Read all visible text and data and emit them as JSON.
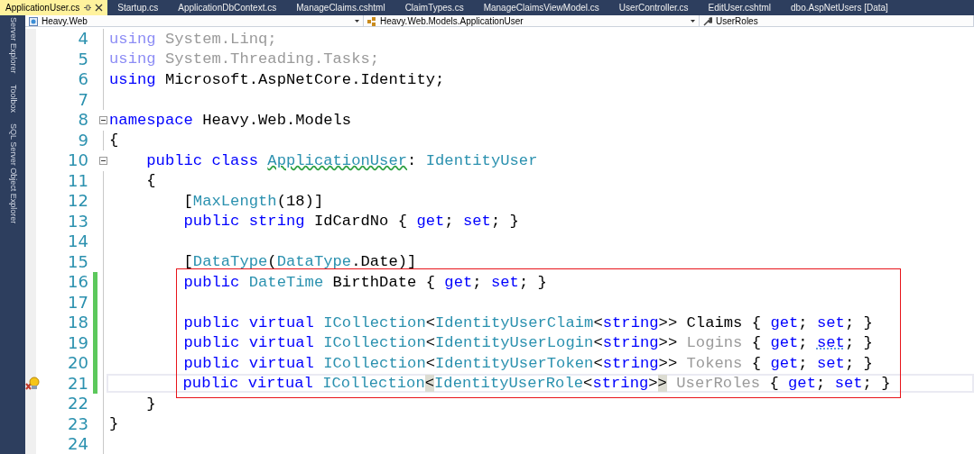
{
  "tabs": [
    {
      "label": "ApplicationUser.cs",
      "selected": true
    },
    {
      "label": "Startup.cs",
      "selected": false
    },
    {
      "label": "ApplicationDbContext.cs",
      "selected": false
    },
    {
      "label": "ManageClaims.cshtml",
      "selected": false
    },
    {
      "label": "ClaimTypes.cs",
      "selected": false
    },
    {
      "label": "ManageClaimsViewModel.cs",
      "selected": false
    },
    {
      "label": "UserController.cs",
      "selected": false
    },
    {
      "label": "EditUser.cshtml",
      "selected": false
    },
    {
      "label": "dbo.AspNetUsers [Data]",
      "selected": false
    }
  ],
  "side_panels": [
    "Server Explorer",
    "Toolbox",
    "SQL Server Object Explorer"
  ],
  "navigation": {
    "project": "Heavy.Web",
    "class": "Heavy.Web.Models.ApplicationUser",
    "member": "UserRoles"
  },
  "lines": [
    {
      "number": "4",
      "changed": false,
      "foldable": false,
      "current": false,
      "lightbulb": false,
      "tokens": [
        {
          "text": "using",
          "kind": "faded-keyword"
        },
        {
          "text": " System.Linq;",
          "kind": "faded"
        }
      ]
    },
    {
      "number": "5",
      "changed": false,
      "foldable": false,
      "current": false,
      "lightbulb": false,
      "tokens": [
        {
          "text": "using",
          "kind": "faded-keyword"
        },
        {
          "text": " System.Threading.Tasks;",
          "kind": "faded"
        }
      ]
    },
    {
      "number": "6",
      "changed": false,
      "foldable": false,
      "current": false,
      "lightbulb": false,
      "tokens": [
        {
          "text": "using",
          "kind": "keyword"
        },
        {
          "text": " Microsoft.AspNetCore.Identity;",
          "kind": "plain"
        }
      ]
    },
    {
      "number": "7",
      "changed": false,
      "foldable": false,
      "current": false,
      "lightbulb": false
    },
    {
      "number": "8",
      "changed": false,
      "foldable": true,
      "current": false,
      "lightbulb": false,
      "tokens": [
        {
          "text": "namespace",
          "kind": "keyword"
        },
        {
          "text": " Heavy.Web.Models",
          "kind": "plain"
        }
      ]
    },
    {
      "number": "9",
      "changed": false,
      "foldable": false,
      "current": false,
      "lightbulb": false,
      "tokens": [
        {
          "text": "{",
          "kind": "plain"
        }
      ]
    },
    {
      "number": "10",
      "changed": false,
      "foldable": true,
      "current": false,
      "lightbulb": false,
      "tokens": [
        {
          "text": "    public class ",
          "kind": "keyword"
        },
        {
          "text": "ApplicationUser",
          "kind": "type-warning"
        },
        {
          "text": ": ",
          "kind": "plain"
        },
        {
          "text": "IdentityUser",
          "kind": "type"
        }
      ]
    },
    {
      "number": "11",
      "changed": false,
      "foldable": false,
      "current": false,
      "lightbulb": false,
      "tokens": [
        {
          "text": "    {",
          "kind": "plain"
        }
      ]
    },
    {
      "number": "12",
      "changed": false,
      "foldable": false,
      "current": false,
      "lightbulb": false,
      "tokens": [
        {
          "text": "        [",
          "kind": "plain"
        },
        {
          "text": "MaxLength",
          "kind": "type"
        },
        {
          "text": "(18)]",
          "kind": "plain"
        }
      ]
    },
    {
      "number": "13",
      "changed": false,
      "foldable": false,
      "current": false,
      "lightbulb": false,
      "tokens": [
        {
          "text": "        public string",
          "kind": "keyword"
        },
        {
          "text": " IdCardNo { ",
          "kind": "plain"
        },
        {
          "text": "get",
          "kind": "keyword"
        },
        {
          "text": "; ",
          "kind": "plain"
        },
        {
          "text": "set",
          "kind": "keyword"
        },
        {
          "text": "; }",
          "kind": "plain"
        }
      ]
    },
    {
      "number": "14",
      "changed": false,
      "foldable": false,
      "current": false,
      "lightbulb": false
    },
    {
      "number": "15",
      "changed": false,
      "foldable": false,
      "current": false,
      "lightbulb": false,
      "tokens": [
        {
          "text": "        [",
          "kind": "plain"
        },
        {
          "text": "DataType",
          "kind": "type"
        },
        {
          "text": "(",
          "kind": "plain"
        },
        {
          "text": "DataType",
          "kind": "type"
        },
        {
          "text": ".Date)]",
          "kind": "plain"
        }
      ]
    },
    {
      "number": "16",
      "changed": true,
      "foldable": false,
      "current": false,
      "lightbulb": false,
      "tokens": [
        {
          "text": "        public ",
          "kind": "keyword"
        },
        {
          "text": "DateTime",
          "kind": "type"
        },
        {
          "text": " BirthDate { ",
          "kind": "plain"
        },
        {
          "text": "get",
          "kind": "keyword"
        },
        {
          "text": "; ",
          "kind": "plain"
        },
        {
          "text": "set",
          "kind": "keyword"
        },
        {
          "text": "; }",
          "kind": "plain"
        }
      ]
    },
    {
      "number": "17",
      "changed": true,
      "foldable": false,
      "current": false,
      "lightbulb": false
    },
    {
      "number": "18",
      "changed": true,
      "foldable": false,
      "current": false,
      "lightbulb": false,
      "tokens": [
        {
          "text": "        public virtual ",
          "kind": "keyword"
        },
        {
          "text": "ICollection",
          "kind": "type"
        },
        {
          "text": "<",
          "kind": "plain"
        },
        {
          "text": "IdentityUserClaim",
          "kind": "type"
        },
        {
          "text": "<",
          "kind": "plain"
        },
        {
          "text": "string",
          "kind": "keyword"
        },
        {
          "text": ">> Claims { ",
          "kind": "plain"
        },
        {
          "text": "get",
          "kind": "keyword"
        },
        {
          "text": "; ",
          "kind": "plain"
        },
        {
          "text": "set",
          "kind": "keyword"
        },
        {
          "text": "; }",
          "kind": "plain"
        }
      ]
    },
    {
      "number": "19",
      "changed": true,
      "foldable": false,
      "current": false,
      "lightbulb": false,
      "tokens": [
        {
          "text": "        public virtual ",
          "kind": "keyword"
        },
        {
          "text": "ICollection",
          "kind": "type"
        },
        {
          "text": "<",
          "kind": "plain"
        },
        {
          "text": "IdentityUserLogin",
          "kind": "type"
        },
        {
          "text": "<",
          "kind": "plain"
        },
        {
          "text": "string",
          "kind": "keyword"
        },
        {
          "text": ">> ",
          "kind": "plain"
        },
        {
          "text": "Logins",
          "kind": "faded"
        },
        {
          "text": " { ",
          "kind": "plain"
        },
        {
          "text": "get",
          "kind": "keyword"
        },
        {
          "text": "; ",
          "kind": "plain"
        },
        {
          "text": "set",
          "kind": "keyword-info"
        },
        {
          "text": "; }",
          "kind": "plain"
        }
      ]
    },
    {
      "number": "20",
      "changed": true,
      "foldable": false,
      "current": false,
      "lightbulb": false,
      "tokens": [
        {
          "text": "        public virtual ",
          "kind": "keyword"
        },
        {
          "text": "ICollection",
          "kind": "type"
        },
        {
          "text": "<",
          "kind": "plain"
        },
        {
          "text": "IdentityUserToken",
          "kind": "type"
        },
        {
          "text": "<",
          "kind": "plain"
        },
        {
          "text": "string",
          "kind": "keyword"
        },
        {
          "text": ">> ",
          "kind": "plain"
        },
        {
          "text": "Tokens",
          "kind": "faded"
        },
        {
          "text": " { ",
          "kind": "plain"
        },
        {
          "text": "get",
          "kind": "keyword"
        },
        {
          "text": "; ",
          "kind": "plain"
        },
        {
          "text": "set",
          "kind": "keyword"
        },
        {
          "text": "; }",
          "kind": "plain"
        }
      ]
    },
    {
      "number": "21",
      "changed": true,
      "foldable": false,
      "current": true,
      "lightbulb": true,
      "tokens": [
        {
          "text": "        public virtual ",
          "kind": "keyword"
        },
        {
          "text": "ICollection",
          "kind": "type"
        },
        {
          "text": "<",
          "kind": "match"
        },
        {
          "text": "IdentityUserRole",
          "kind": "type"
        },
        {
          "text": "<",
          "kind": "plain"
        },
        {
          "text": "string",
          "kind": "keyword"
        },
        {
          "text": ">",
          "kind": "plain"
        },
        {
          "text": ">",
          "kind": "match"
        },
        {
          "text": " UserRoles",
          "kind": "faded"
        },
        {
          "text": " { ",
          "kind": "plain"
        },
        {
          "text": "get",
          "kind": "keyword"
        },
        {
          "text": "; ",
          "kind": "plain"
        },
        {
          "text": "set",
          "kind": "keyword"
        },
        {
          "text": "; }",
          "kind": "plain"
        }
      ]
    },
    {
      "number": "22",
      "changed": false,
      "foldable": false,
      "current": false,
      "lightbulb": false,
      "tokens": [
        {
          "text": "    }",
          "kind": "plain"
        }
      ]
    },
    {
      "number": "23",
      "changed": false,
      "foldable": false,
      "current": false,
      "lightbulb": false,
      "tokens": [
        {
          "text": "}",
          "kind": "plain"
        }
      ]
    },
    {
      "number": "24",
      "changed": false,
      "foldable": false,
      "current": false,
      "lightbulb": false
    }
  ]
}
